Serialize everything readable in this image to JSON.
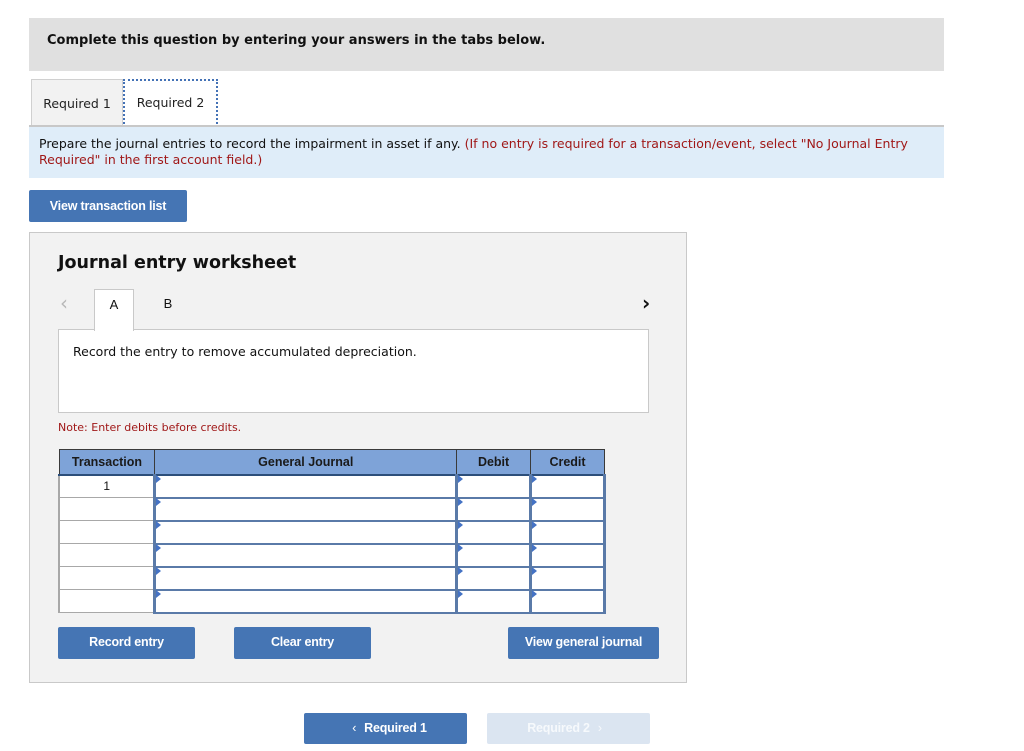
{
  "header": {
    "title": "Complete this question by entering your answers in the tabs below."
  },
  "tabs": [
    {
      "label": "Required 1",
      "active": false
    },
    {
      "label": "Required 2",
      "active": true
    }
  ],
  "instructions": {
    "text": "Prepare the journal entries to record the impairment in asset if any.",
    "note": "(If no entry is required for a transaction/event, select \"No Journal Entry Required\" in the first account field.)"
  },
  "buttons": {
    "view_transaction_list": "View transaction list",
    "record_entry": "Record entry",
    "clear_entry": "Clear entry",
    "view_general_journal": "View general journal"
  },
  "worksheet": {
    "title": "Journal entry worksheet",
    "prev_icon": "chevron-left-icon",
    "next_icon": "chevron-right-icon",
    "entry_tabs": [
      {
        "label": "A",
        "active": true
      },
      {
        "label": "B",
        "active": false
      }
    ],
    "description": "Record the entry to remove accumulated depreciation.",
    "note": "Note: Enter debits before credits.",
    "table": {
      "columns": [
        "Transaction",
        "General Journal",
        "Debit",
        "Credit"
      ],
      "rows": [
        {
          "transaction": "1",
          "account": "",
          "debit": "",
          "credit": ""
        },
        {
          "transaction": "",
          "account": "",
          "debit": "",
          "credit": ""
        },
        {
          "transaction": "",
          "account": "",
          "debit": "",
          "credit": ""
        },
        {
          "transaction": "",
          "account": "",
          "debit": "",
          "credit": ""
        },
        {
          "transaction": "",
          "account": "",
          "debit": "",
          "credit": ""
        },
        {
          "transaction": "",
          "account": "",
          "debit": "",
          "credit": ""
        }
      ]
    }
  },
  "navigation": {
    "prev_label": "Required 1",
    "next_label": "Required 2",
    "prev_icon": "‹",
    "next_icon": "›"
  },
  "colors": {
    "primary_button": "#4575b4",
    "disabled_button": "#dbe5f1",
    "table_header": "#7ea3d8",
    "note_red": "#a01818",
    "instructions_bg": "#dfedf9"
  }
}
